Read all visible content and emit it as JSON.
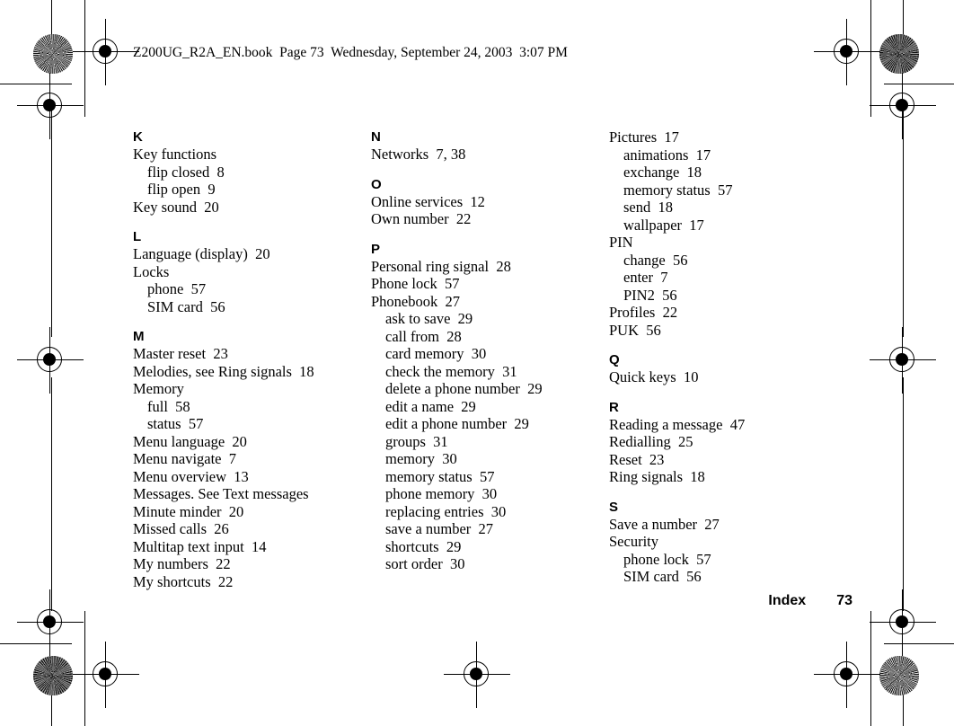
{
  "document": {
    "slug_line": "Z200UG_R2A_EN.book  Page 73  Wednesday, September 24, 2003  3:07 PM",
    "footer_label": "Index",
    "footer_page": "73"
  },
  "columns": [
    {
      "id": "column-1",
      "sections": [
        {
          "letter": "K",
          "entries": [
            {
              "text": "Key functions",
              "level": 0
            },
            {
              "text": "flip closed  8",
              "level": 1
            },
            {
              "text": "flip open  9",
              "level": 1
            },
            {
              "text": "Key sound  20",
              "level": 0
            }
          ]
        },
        {
          "letter": "L",
          "entries": [
            {
              "text": "Language (display)  20",
              "level": 0
            },
            {
              "text": "Locks",
              "level": 0
            },
            {
              "text": "phone  57",
              "level": 1
            },
            {
              "text": "SIM card  56",
              "level": 1
            }
          ]
        },
        {
          "letter": "M",
          "entries": [
            {
              "text": "Master reset  23",
              "level": 0
            },
            {
              "text": "Melodies, see Ring signals  18",
              "level": 0
            },
            {
              "text": "Memory",
              "level": 0
            },
            {
              "text": "full  58",
              "level": 1
            },
            {
              "text": "status  57",
              "level": 1
            },
            {
              "text": "Menu language  20",
              "level": 0
            },
            {
              "text": "Menu navigate  7",
              "level": 0
            },
            {
              "text": "Menu overview  13",
              "level": 0
            },
            {
              "text": "Messages. See Text messages",
              "level": 0
            },
            {
              "text": "Minute minder  20",
              "level": 0
            },
            {
              "text": "Missed calls  26",
              "level": 0
            },
            {
              "text": "Multitap text input  14",
              "level": 0
            },
            {
              "text": "My numbers  22",
              "level": 0
            },
            {
              "text": "My shortcuts  22",
              "level": 0
            }
          ]
        }
      ]
    },
    {
      "id": "column-2",
      "sections": [
        {
          "letter": "N",
          "entries": [
            {
              "text": "Networks  7, 38",
              "level": 0
            }
          ]
        },
        {
          "letter": "O",
          "entries": [
            {
              "text": "Online services  12",
              "level": 0
            },
            {
              "text": "Own number  22",
              "level": 0
            }
          ]
        },
        {
          "letter": "P",
          "entries": [
            {
              "text": "Personal ring signal  28",
              "level": 0
            },
            {
              "text": "Phone lock  57",
              "level": 0
            },
            {
              "text": "Phonebook  27",
              "level": 0
            },
            {
              "text": "ask to save  29",
              "level": 1
            },
            {
              "text": "call from  28",
              "level": 1
            },
            {
              "text": "card memory  30",
              "level": 1
            },
            {
              "text": "check the memory  31",
              "level": 1
            },
            {
              "text": "delete a phone number  29",
              "level": 1
            },
            {
              "text": "edit a name  29",
              "level": 1
            },
            {
              "text": "edit a phone number  29",
              "level": 1
            },
            {
              "text": "groups  31",
              "level": 1
            },
            {
              "text": "memory  30",
              "level": 1
            },
            {
              "text": "memory status  57",
              "level": 1
            },
            {
              "text": "phone memory  30",
              "level": 1
            },
            {
              "text": "replacing entries  30",
              "level": 1
            },
            {
              "text": "save a number  27",
              "level": 1
            },
            {
              "text": "shortcuts  29",
              "level": 1
            },
            {
              "text": "sort order  30",
              "level": 1
            }
          ]
        }
      ]
    },
    {
      "id": "column-3",
      "sections": [
        {
          "letter": "",
          "entries": [
            {
              "text": "Pictures  17",
              "level": 0
            },
            {
              "text": "animations  17",
              "level": 1
            },
            {
              "text": "exchange  18",
              "level": 1
            },
            {
              "text": "memory status  57",
              "level": 1
            },
            {
              "text": "send  18",
              "level": 1
            },
            {
              "text": "wallpaper  17",
              "level": 1
            },
            {
              "text": "PIN",
              "level": 0
            },
            {
              "text": "change  56",
              "level": 1
            },
            {
              "text": "enter  7",
              "level": 1
            },
            {
              "text": "PIN2  56",
              "level": 1
            },
            {
              "text": "Profiles  22",
              "level": 0
            },
            {
              "text": "PUK  56",
              "level": 0
            }
          ]
        },
        {
          "letter": "Q",
          "entries": [
            {
              "text": "Quick keys  10",
              "level": 0
            }
          ]
        },
        {
          "letter": "R",
          "entries": [
            {
              "text": "Reading a message  47",
              "level": 0
            },
            {
              "text": "Redialling  25",
              "level": 0
            },
            {
              "text": "Reset  23",
              "level": 0
            },
            {
              "text": "Ring signals  18",
              "level": 0
            }
          ]
        },
        {
          "letter": "S",
          "entries": [
            {
              "text": "Save a number  27",
              "level": 0
            },
            {
              "text": "Security",
              "level": 0
            },
            {
              "text": "phone lock  57",
              "level": 1
            },
            {
              "text": "SIM card  56",
              "level": 1
            }
          ]
        }
      ]
    }
  ],
  "print_marks": {
    "registration_mark_label": "registration-target",
    "star_wheel_label": "star-target",
    "crop_line_label": "crop-line"
  }
}
